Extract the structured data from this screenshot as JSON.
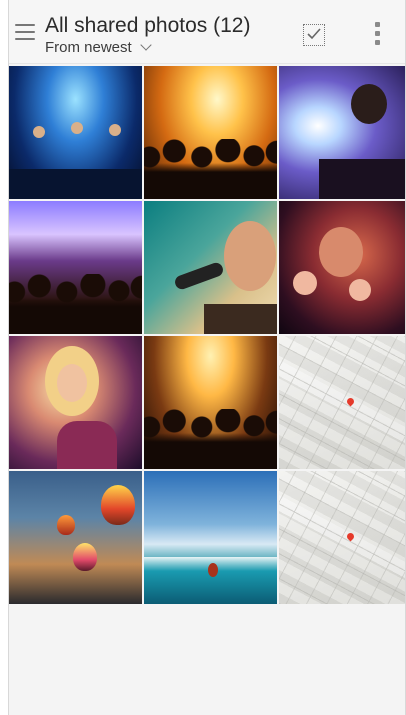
{
  "header": {
    "title": "All shared photos (12)",
    "sort_label": "From newest",
    "menu_icon": "hamburger-menu-icon",
    "select_icon": "select-all-checkbox-icon",
    "more_icon": "more-vertical-icon"
  },
  "photos": [
    {
      "name": "photo-band-on-stage"
    },
    {
      "name": "photo-concert-crowd-orange-lights"
    },
    {
      "name": "photo-dj-with-headphones"
    },
    {
      "name": "photo-concert-crowd-purple-lights"
    },
    {
      "name": "photo-man-singing-microphone"
    },
    {
      "name": "photo-man-singing-crowd"
    },
    {
      "name": "photo-woman-singing-microphone"
    },
    {
      "name": "photo-concert-crowd-hands-up"
    },
    {
      "name": "photo-3d-city-map"
    },
    {
      "name": "photo-hot-air-balloons"
    },
    {
      "name": "photo-surfer-wave"
    },
    {
      "name": "photo-3d-city-map-2"
    }
  ],
  "colors": {
    "header_bg": "#f6f6f6",
    "page_bg": "#f4f4f4",
    "title_text": "#2b2b2b"
  }
}
